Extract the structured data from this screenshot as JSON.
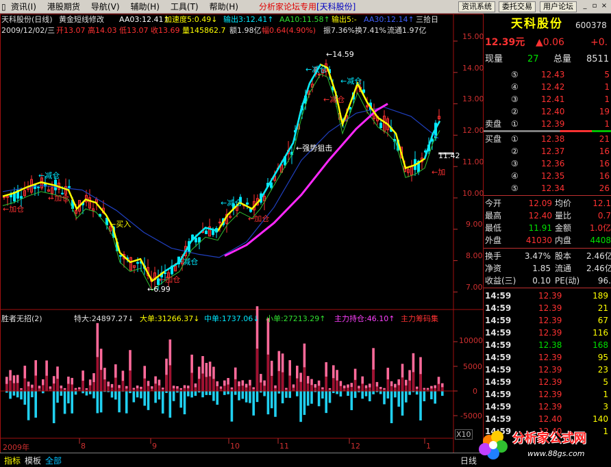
{
  "menu": {
    "items": [
      "资讯(I)",
      "港股期货",
      "导航(V)",
      "辅助(H)",
      "工具(T)",
      "帮助(H)"
    ],
    "promo": "分析家论坛专用",
    "stock_tag": "[天科股份]",
    "right_buttons": [
      "资讯系统",
      "委托交易",
      "用户论坛"
    ]
  },
  "chart_header": {
    "line1_name": "天科股份(日线)",
    "line1_indicator": "黄金短线修改",
    "aa03": "AA03:12.41↑",
    "speed": "加速度5:0.49↓",
    "output3": "输出3:12.41↑",
    "aa10": "AA10:11.58↑",
    "output5": "输出5:-",
    "aa30": "AA30:12.14↑",
    "period": "三拾日",
    "line2_date": "2009/12/02/三",
    "open": "开13.07",
    "high": "高14.03",
    "low": "低13.07",
    "close": "收13.69",
    "volume": "量145862.7",
    "amount": "额1.98亿",
    "change": "幅0.64(4.90%)",
    "amplitude": "振7.36%",
    "turnover": "换7.41%",
    "float": "流通1.97亿"
  },
  "price_axis": [
    "15.00",
    "14.00",
    "13.00",
    "12.00",
    "11.00",
    "10.00",
    "9.00",
    "8.00",
    "7.00"
  ],
  "annotations": {
    "peak": "14.59",
    "bottom": "6.99",
    "current": "11.42",
    "add1": "加仓",
    "add2": "加仓",
    "add3": "加仓",
    "add4": "加仓",
    "add5": "加",
    "reduce1": "减仓",
    "reduce2": "减仓",
    "reduce3": "减仓",
    "reduce4": "减仓",
    "reduce5": "减仓",
    "reduce6": "减仓",
    "buy": "买入",
    "strong": "强势狙击"
  },
  "sub_header": {
    "name": "胜者无招(2)",
    "large": "特大:24897.27↓",
    "big": "大单:31266.37↓",
    "mid": "中单:1737.06↓",
    "small": "小单:27213.29↑",
    "main_hold": "主力持仓:46.10↑",
    "main_chip": "主力筹码集"
  },
  "sub_axis": [
    "10000",
    "5000",
    "0",
    "-5000"
  ],
  "x10": "X10",
  "time_axis": [
    "2009年",
    "8",
    "9",
    "10",
    "11",
    "12",
    "1"
  ],
  "status": {
    "tabs": [
      "指标",
      "模板",
      "全部"
    ],
    "right": "日线"
  },
  "quote": {
    "name": "天科股份",
    "code": "600378",
    "price": "12.39元",
    "change": "▲0.06",
    "pct": "+0.",
    "now_label": "现量",
    "now_val": "27",
    "total_label": "总量",
    "total_val": "8511",
    "sells": [
      {
        "lvl": "⑤",
        "price": "12.43",
        "vol": "5"
      },
      {
        "lvl": "④",
        "price": "12.42",
        "vol": "1"
      },
      {
        "lvl": "③",
        "price": "12.41",
        "vol": "1"
      },
      {
        "lvl": "②",
        "price": "12.40",
        "vol": "19"
      },
      {
        "lvl": "①",
        "price": "12.39",
        "vol": "1"
      }
    ],
    "sell_label": "卖盘",
    "buy_label": "买盘",
    "buys": [
      {
        "lvl": "①",
        "price": "12.38",
        "vol": "21"
      },
      {
        "lvl": "②",
        "price": "12.37",
        "vol": "16"
      },
      {
        "lvl": "③",
        "price": "12.36",
        "vol": "16"
      },
      {
        "lvl": "④",
        "price": "12.35",
        "vol": "16"
      },
      {
        "lvl": "⑤",
        "price": "12.34",
        "vol": "26"
      }
    ],
    "stats": [
      {
        "l": "今开",
        "v": "12.09",
        "l2": "均价",
        "v2": "12.1"
      },
      {
        "l": "最高",
        "v": "12.40",
        "l2": "量比",
        "v2": "0.7"
      },
      {
        "l": "最低",
        "v": "11.91",
        "l2": "金额",
        "v2": "1.0亿"
      },
      {
        "l": "外盘",
        "v": "41030",
        "l2": "内盘",
        "v2": "4408"
      }
    ],
    "stats2": [
      {
        "l": "换手",
        "v": "3.47%",
        "l2": "股本",
        "v2": "2.46亿"
      },
      {
        "l": "净资",
        "v": "1.85",
        "l2": "流通",
        "v2": "2.46亿"
      },
      {
        "l": "收益(三)",
        "v": "0.10",
        "l2": "PE(动)",
        "v2": "96."
      }
    ],
    "ticks": [
      {
        "t": "14:59",
        "p": "12.39",
        "v": "189"
      },
      {
        "t": "14:59",
        "p": "12.39",
        "v": "21"
      },
      {
        "t": "14:59",
        "p": "12.39",
        "v": "67"
      },
      {
        "t": "14:59",
        "p": "12.39",
        "v": "116"
      },
      {
        "t": "14:59",
        "p": "12.38",
        "v": "168"
      },
      {
        "t": "14:59",
        "p": "12.39",
        "v": "95"
      },
      {
        "t": "14:59",
        "p": "12.39",
        "v": "23"
      },
      {
        "t": "14:59",
        "p": "12.39",
        "v": "5"
      },
      {
        "t": "14:59",
        "p": "12.39",
        "v": "1"
      },
      {
        "t": "14:59",
        "p": "12.39",
        "v": "3"
      },
      {
        "t": "14:59",
        "p": "12.40",
        "v": "140"
      },
      {
        "t": "14:59",
        "p": "12.40",
        "v": "1"
      }
    ]
  },
  "watermark": {
    "text": "分析家公式网",
    "url": "www.88gs.com"
  },
  "colors": {
    "up": "#ff3232",
    "down": "#00e000",
    "ma_cyan": "#00e8ff",
    "ma_yellow": "#ffff00",
    "ma_magenta": "#ff28ff",
    "ma_blue": "#2040c0",
    "ma_green": "#30c030"
  }
}
